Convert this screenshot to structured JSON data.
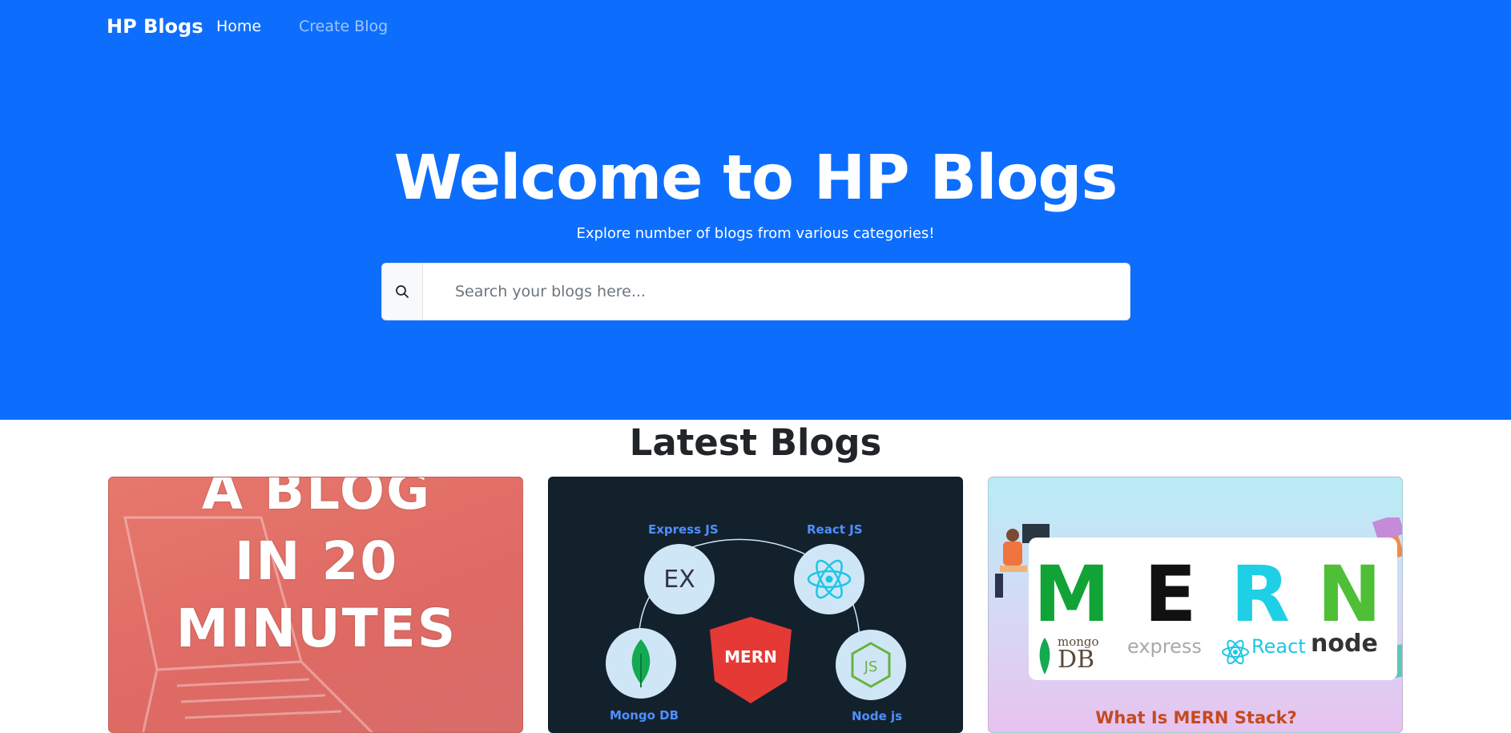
{
  "navbar": {
    "brand": "HP Blogs",
    "links": [
      "Home",
      "Create Blog"
    ]
  },
  "hero": {
    "title": "Welcome to HP Blogs",
    "subtitle": "Explore number of blogs from various categories!",
    "search": {
      "placeholder": "Search your blogs here...",
      "icon": "search-icon"
    }
  },
  "latest": {
    "title": "Latest Blogs",
    "cards": [
      {
        "image_text": [
          "A BLOG",
          "IN 20",
          "MINUTES"
        ]
      },
      {
        "labels": [
          "Express JS",
          "React JS",
          "Mongo DB",
          "Node js"
        ],
        "center": "MERN",
        "ex_text": "EX",
        "js_text": "JS"
      },
      {
        "letters": [
          "M",
          "E",
          "R",
          "N"
        ],
        "logos": [
          "mongo",
          "DB",
          "express",
          "React",
          "node"
        ],
        "caption": "What Is MERN Stack?"
      }
    ]
  },
  "colors": {
    "primary": "#0d6efd",
    "mern_red": "#e53935",
    "m_green": "#12a336",
    "r_cyan": "#1ecfe6",
    "n_green": "#4fbf37"
  }
}
